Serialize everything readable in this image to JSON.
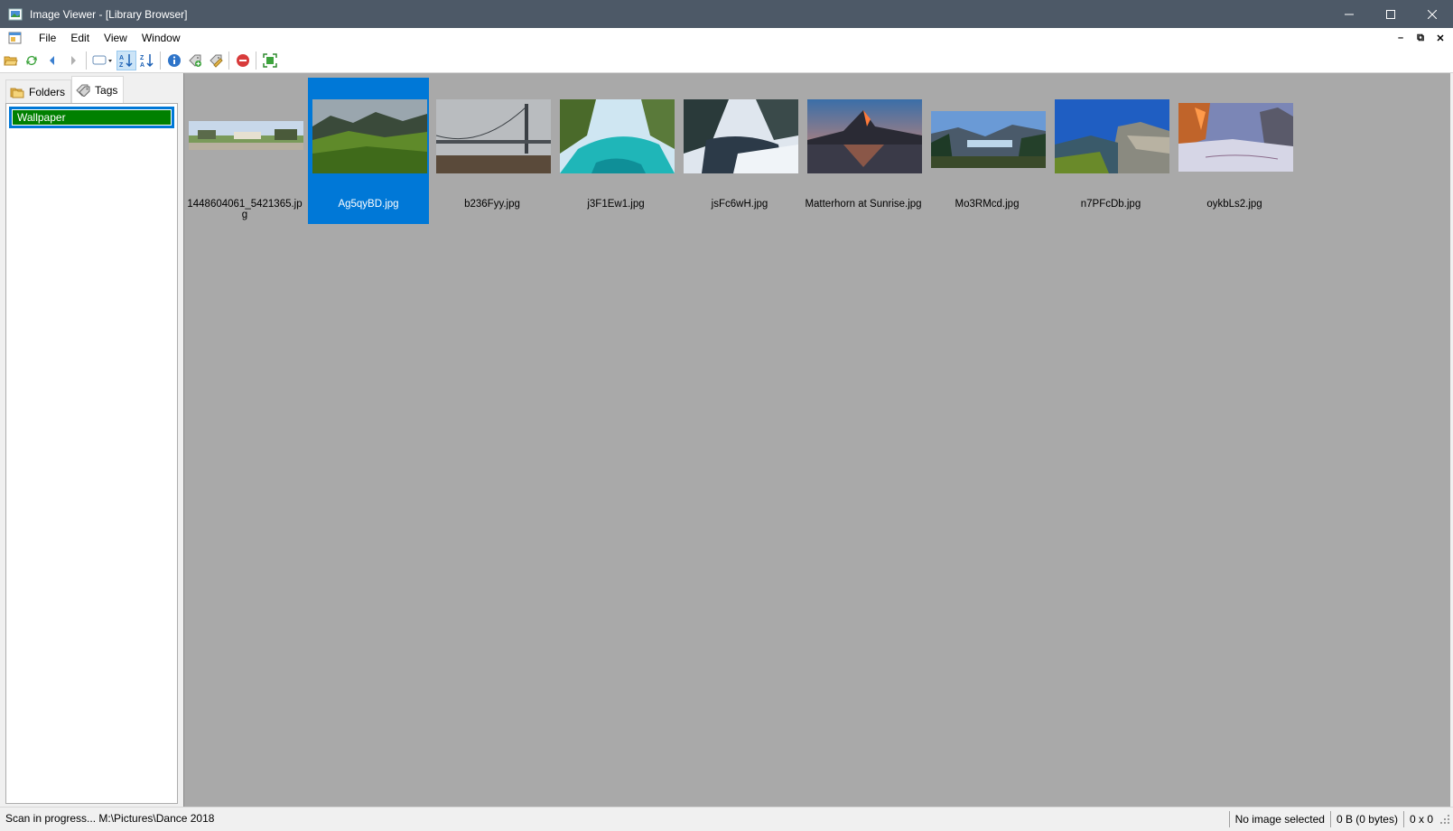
{
  "window": {
    "title": "Image Viewer - [Library Browser]",
    "icons": {
      "app": "image-viewer-icon",
      "minimize": "minimize-icon",
      "maximize": "maximize-icon",
      "close": "close-icon"
    }
  },
  "menubar": {
    "items": [
      "File",
      "Edit",
      "View",
      "Window"
    ],
    "mdi_controls": [
      "minimize-child-icon",
      "restore-child-icon",
      "close-child-icon"
    ]
  },
  "toolbar": {
    "buttons": [
      "open-folder-icon",
      "refresh-icon",
      "back-icon",
      "forward-icon",
      "view-mode-dropdown-icon",
      "sort-ascending-icon",
      "sort-descending-icon",
      "info-icon",
      "add-tag-icon",
      "edit-tag-icon",
      "stop-icon",
      "fit-screen-icon"
    ]
  },
  "leftpane": {
    "tabs": [
      {
        "label": "Folders",
        "icon": "folders-icon",
        "active": false
      },
      {
        "label": "Tags",
        "icon": "tags-icon",
        "active": true
      }
    ],
    "tags": [
      "Wallpaper"
    ]
  },
  "thumbnails": [
    {
      "name": "1448604061_5421365.jpg",
      "selected": false
    },
    {
      "name": "Ag5qyBD.jpg",
      "selected": true
    },
    {
      "name": "b236Fyy.jpg",
      "selected": false
    },
    {
      "name": "j3F1Ew1.jpg",
      "selected": false
    },
    {
      "name": "jsFc6wH.jpg",
      "selected": false
    },
    {
      "name": "Matterhorn at Sunrise.jpg",
      "selected": false
    },
    {
      "name": "Mo3RMcd.jpg",
      "selected": false
    },
    {
      "name": "n7PFcDb.jpg",
      "selected": false
    },
    {
      "name": "oykbLs2.jpg",
      "selected": false
    }
  ],
  "statusbar": {
    "scan_status": "Scan in progress... M:\\Pictures\\Dance 2018",
    "selection": "No image selected",
    "size": "0 B (0 bytes)",
    "dimensions": "0 x 0"
  }
}
